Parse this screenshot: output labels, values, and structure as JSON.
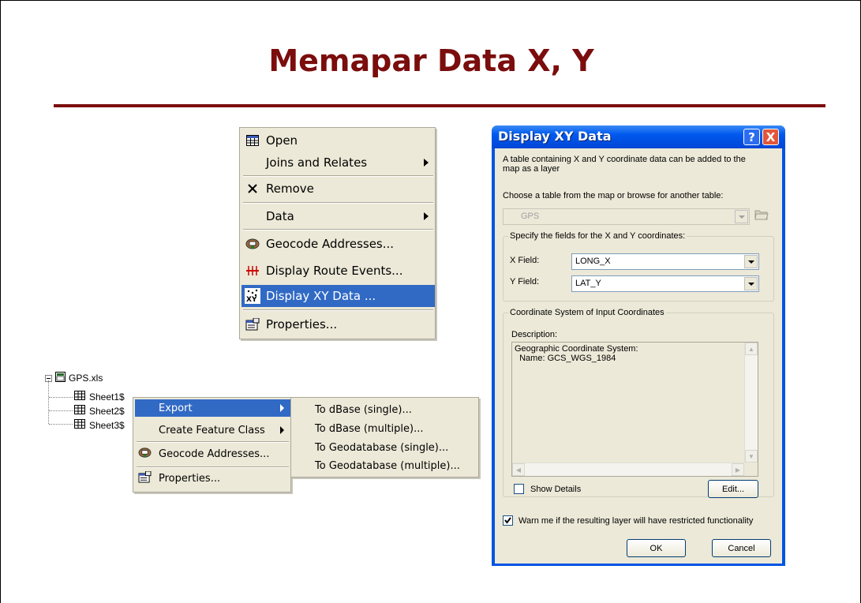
{
  "slide": {
    "title": "Memapar Data X, Y"
  },
  "context_menu": {
    "items": [
      {
        "label": "Open",
        "icon": "table-icon",
        "underline": "O"
      },
      {
        "label": "Joins and Relates",
        "submenu": true
      },
      {
        "label": "Remove",
        "icon": "close-x-icon"
      },
      {
        "label": "Data",
        "submenu": true
      },
      {
        "label": "Geocode Addresses...",
        "icon": "geocode-icon"
      },
      {
        "label": "Display Route Events...",
        "icon": "route-events-icon"
      },
      {
        "label": "Display XY Data ...",
        "icon": "xy-data-icon",
        "selected": true
      },
      {
        "label": "Properties...",
        "icon": "properties-icon"
      }
    ]
  },
  "tree": {
    "root": "GPS.xls",
    "sheets": [
      "Sheet1$",
      "Sheet2$",
      "Sheet3$"
    ]
  },
  "sheet_menu": {
    "items": [
      {
        "label": "Export",
        "submenu": true,
        "selected": true
      },
      {
        "label": "Create Feature Class",
        "submenu": true
      },
      {
        "label": "Geocode Addresses...",
        "icon": "geocode-icon"
      },
      {
        "label": "Properties...",
        "icon": "properties-icon"
      }
    ]
  },
  "export_submenu": {
    "items": [
      "To dBase (single)...",
      "To dBase (multiple)...",
      "To Geodatabase (single)...",
      "To Geodatabase (multiple)..."
    ]
  },
  "dialog": {
    "title": "Display XY Data",
    "help_label": "?",
    "close_label": "X",
    "intro": "A table containing X and Y coordinate data can be added to the map as a layer",
    "choose_label": "Choose a table from the map or browse for another table:",
    "table_value": "GPS",
    "fields_group": "Specify the fields for the X and Y coordinates:",
    "x_label": "X Field:",
    "x_value": "LONG_X",
    "y_label": "Y Field:",
    "y_value": "LAT_Y",
    "coord_group": "Coordinate System of Input Coordinates",
    "description_label": "Description:",
    "description_lines": [
      "Geographic Coordinate System:",
      "  Name: GCS_WGS_1984"
    ],
    "show_details_label": "Show Details",
    "show_details_checked": false,
    "edit_label": "Edit...",
    "warn_label": "Warn me if the resulting layer will have restricted functionality",
    "warn_checked": true,
    "ok_label": "OK",
    "cancel_label": "Cancel"
  }
}
